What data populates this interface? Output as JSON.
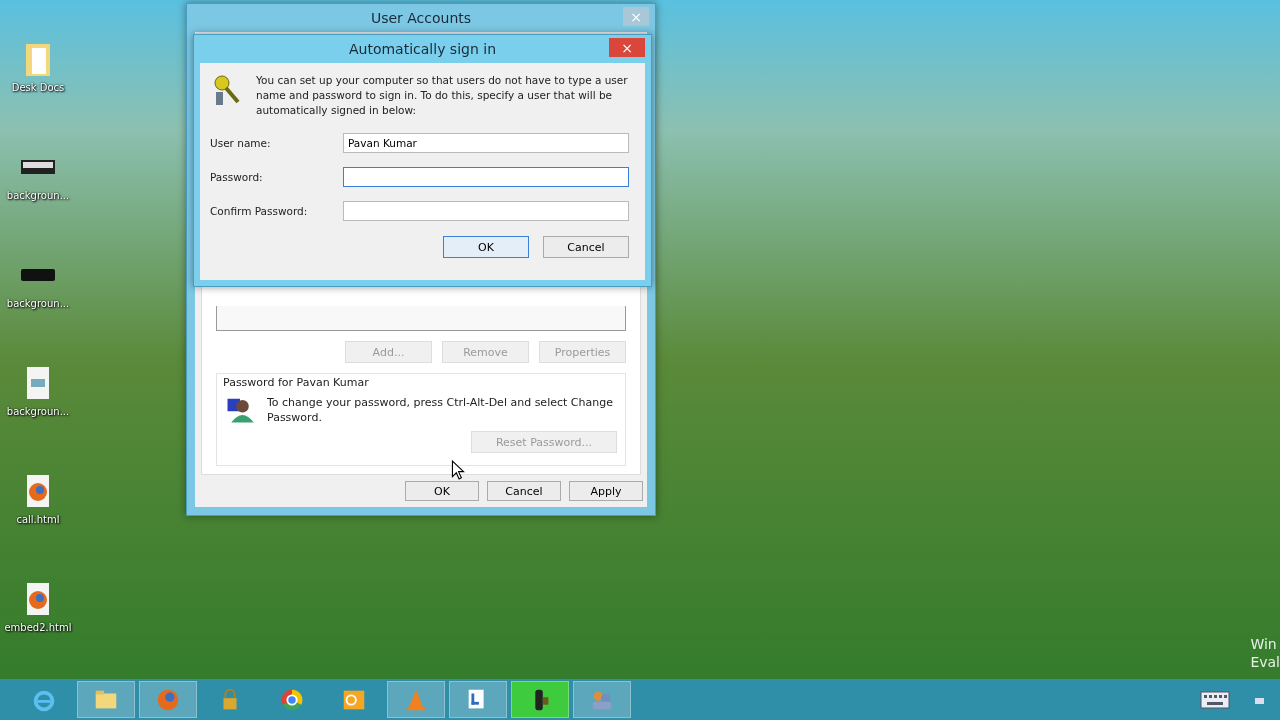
{
  "desktop_icons": [
    {
      "label": "Desk Docs",
      "kind": "folder"
    },
    {
      "label": "backgroun...",
      "kind": "image-strip"
    },
    {
      "label": "backgroun...",
      "kind": "dark-strip"
    },
    {
      "label": "backgroun...",
      "kind": "file"
    },
    {
      "label": "call.html",
      "kind": "browser-file"
    },
    {
      "label": "embed2.html",
      "kind": "browser-file"
    }
  ],
  "user_accounts": {
    "title": "User Accounts",
    "close": "×",
    "list_buttons": [
      {
        "label": "Add...",
        "disabled": true
      },
      {
        "label": "Remove",
        "disabled": true
      },
      {
        "label": "Properties",
        "disabled": true
      }
    ],
    "group_title": "Password for Pavan Kumar",
    "group_text": "To change your password, press Ctrl-Alt-Del and select Change Password.",
    "reset_button": {
      "label": "Reset Password...",
      "disabled": true
    },
    "buttons": [
      {
        "label": "OK"
      },
      {
        "label": "Cancel"
      },
      {
        "label": "Apply"
      }
    ]
  },
  "sign_in": {
    "title": "Automatically sign in",
    "close": "×",
    "description": "You can set up your computer so that users do not have to type a user name and password to sign in. To do this, specify a user that will be automatically signed in below:",
    "fields": [
      {
        "label": "User name:",
        "value": "Pavan Kumar",
        "focused": false,
        "kind": "text"
      },
      {
        "label": "Password:",
        "focused": true,
        "kind": "password"
      },
      {
        "label": "Confirm Password:",
        "focused": false,
        "kind": "password"
      }
    ],
    "buttons": [
      {
        "label": "OK",
        "default": true
      },
      {
        "label": "Cancel",
        "default": false
      }
    ]
  },
  "watermark_lines": [
    "Win",
    "Eval"
  ],
  "taskbar": [
    {
      "kind": "ie",
      "running": false
    },
    {
      "kind": "folder",
      "running": true
    },
    {
      "kind": "firefox",
      "running": true
    },
    {
      "kind": "lock",
      "running": false
    },
    {
      "kind": "chrome",
      "running": false
    },
    {
      "kind": "outlook",
      "running": false
    },
    {
      "kind": "vlc",
      "running": true
    },
    {
      "kind": "lync",
      "running": true
    },
    {
      "kind": "camera",
      "running": true,
      "selected": true
    },
    {
      "kind": "users",
      "running": true,
      "selected": false
    }
  ]
}
